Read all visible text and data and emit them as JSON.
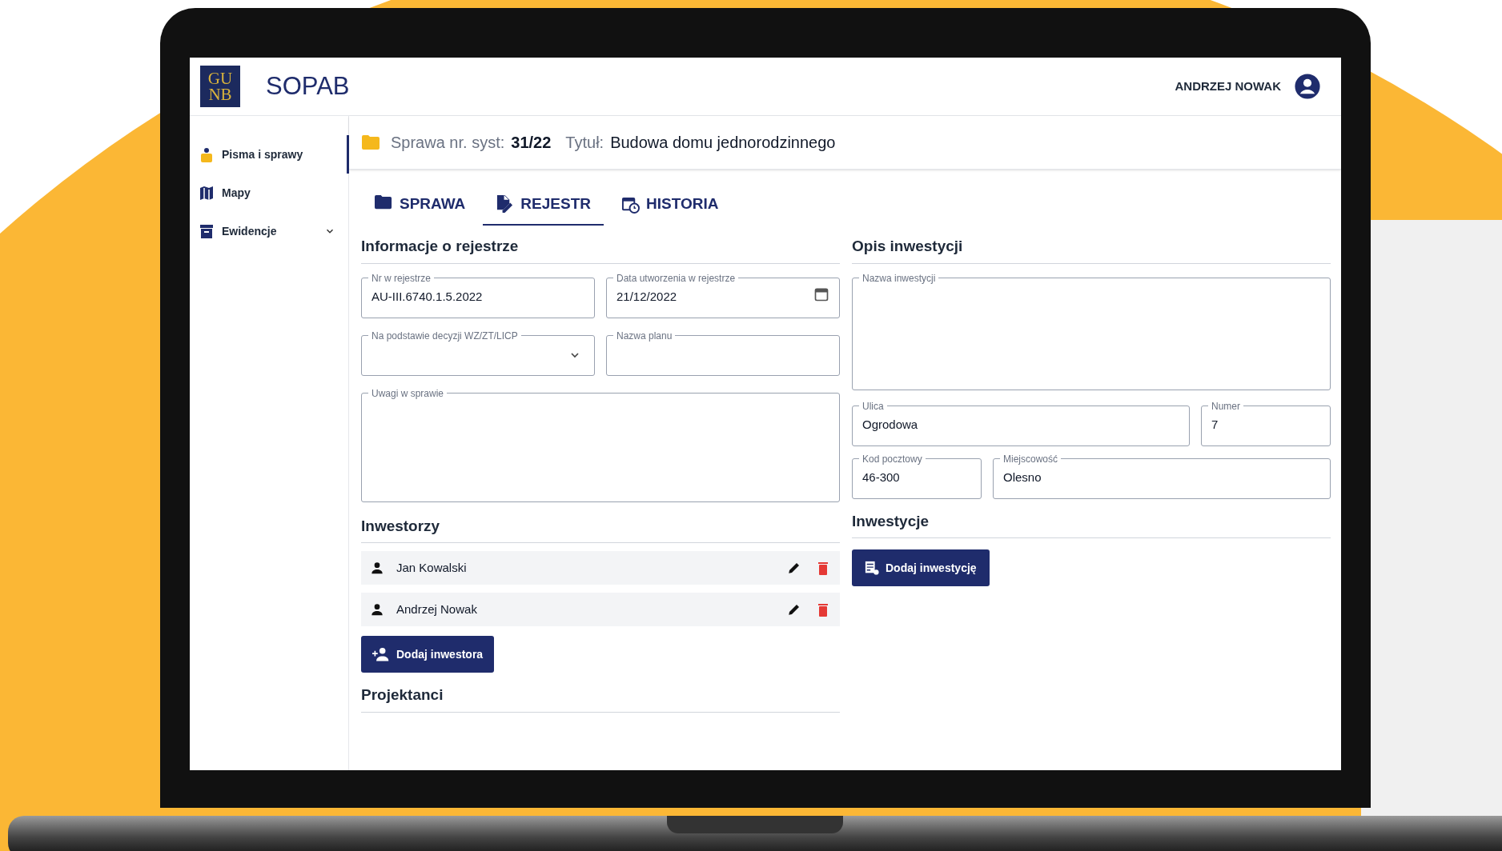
{
  "header": {
    "logo_lines": [
      "GU",
      "NB"
    ],
    "app_name": "SOPAB",
    "user_name": "ANDRZEJ NOWAK"
  },
  "sidebar": {
    "items": [
      {
        "label": "Pisma i sprawy",
        "selected": true
      },
      {
        "label": "Mapy",
        "selected": false
      },
      {
        "label": "Ewidencje",
        "selected": false,
        "expanded": false
      }
    ]
  },
  "case_bar": {
    "number_label": "Sprawa nr. syst:",
    "number": "31/22",
    "title_label": "Tytuł:",
    "title": "Budowa domu jednorodzinnego"
  },
  "tabs": [
    {
      "label": "SPRAWA",
      "selected": false
    },
    {
      "label": "REJESTR",
      "selected": true
    },
    {
      "label": "HISTORIA",
      "selected": false
    }
  ],
  "register_info": {
    "heading": "Informacje o rejestrze",
    "fields": [
      {
        "kind": "text",
        "label": "Nr w rejestrze",
        "value": "AU-III.6740.1.5.2022"
      },
      {
        "kind": "date",
        "label": "Data utworzenia w rejestrze",
        "value": "21/12/2022"
      },
      {
        "kind": "select",
        "label": "Na podstawie decyzji WZ/ZT/LICP"
      },
      {
        "kind": "text",
        "label": "Nazwa planu"
      },
      {
        "kind": "textarea",
        "label": "Uwagi w sprawie"
      }
    ]
  },
  "investment_description": {
    "heading": "Opis inwestycji",
    "fields": [
      {
        "kind": "textarea",
        "label": "Nazwa inwestycji"
      },
      {
        "kind": "text",
        "label": "Ulica",
        "value": "Ogrodowa"
      },
      {
        "kind": "text",
        "label": "Numer",
        "value": "7"
      },
      {
        "kind": "text",
        "label": "Kod pocztowy",
        "value": "46-300"
      },
      {
        "kind": "text",
        "label": "Miejscowość",
        "value": "Olesno"
      }
    ]
  },
  "investors": {
    "heading": "Inwestorzy",
    "items": [
      {
        "name": "Jan Kowalski"
      },
      {
        "name": "Andrzej Nowak"
      }
    ],
    "add_button": "Dodaj inwestora"
  },
  "investments": {
    "heading": "Inwestycje",
    "add_button": "Dodaj inwestycję"
  },
  "designers": {
    "heading": "Projektanci"
  }
}
